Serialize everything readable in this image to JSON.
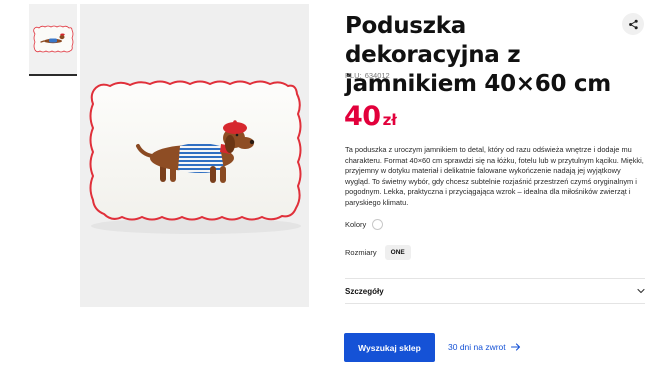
{
  "product": {
    "title": "Poduszka dekoracyjna z jamnikiem 40×60 cm",
    "plu_label": "PLU:",
    "plu_value": "634012",
    "price_value": "40",
    "price_currency": "zł",
    "description": "Ta poduszka z uroczym jamnikiem to detal, który od razu odświeża wnętrze i dodaje mu charakteru. Format 40×60 cm sprawdzi się na łóżku, fotelu lub w przytulnym kąciku. Miękki, przyjemny w dotyku materiał i delikatnie falowane wykończenie nadają jej wyjątkowy wygląd. To świetny wybór, gdy chcesz subtelnie rozjaśnić przestrzeń czymś oryginalnym i pogodnym. Lekka, praktyczna i przyciągająca wzrok – idealna dla miłośników zwierząt i paryskiego klimatu."
  },
  "options": {
    "colors_label": "Kolory",
    "sizes_label": "Rozmiary",
    "sizes": [
      "ONE"
    ]
  },
  "details": {
    "label": "Szczegóły"
  },
  "actions": {
    "find_store_label": "Wyszukaj sklep",
    "return_label": "30 dni na zwrot"
  },
  "icons": {
    "share": "share-icon",
    "chevron": "chevron-down-icon",
    "arrow": "arrow-right-icon"
  },
  "colors": {
    "accent_price": "#e2003b",
    "primary_button": "#1552d6",
    "pillow_trim": "#e0303a"
  }
}
